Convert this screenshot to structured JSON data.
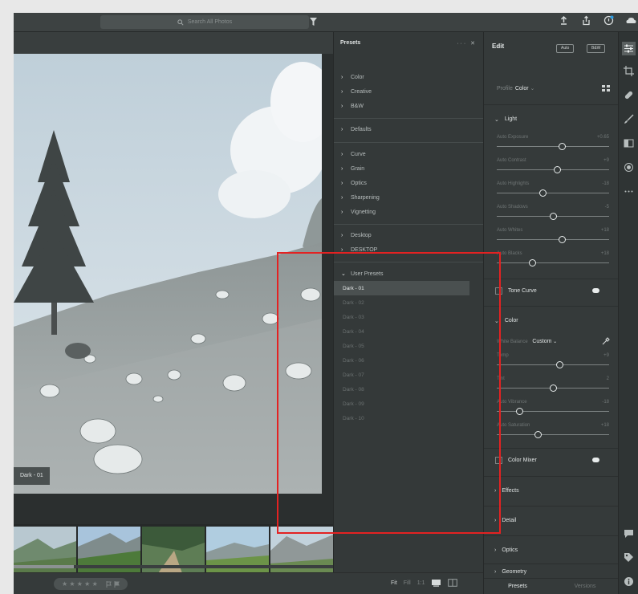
{
  "search": {
    "placeholder": "Search All Photos"
  },
  "photo": {
    "label": "Dark - 01"
  },
  "presets": {
    "title": "Presets",
    "controls": "··· ✕",
    "groups": [
      [
        "Color",
        "Creative",
        "B&W"
      ],
      [
        "Defaults"
      ],
      [
        "Curve",
        "Grain",
        "Optics",
        "Sharpening",
        "Vignetting"
      ],
      [
        "Desktop",
        "DESKTOP"
      ]
    ],
    "user_presets": {
      "title": "User Presets",
      "items": [
        "Dark - 01",
        "Dark - 02",
        "Dark - 03",
        "Dark - 04",
        "Dark - 05",
        "Dark - 06",
        "Dark - 07",
        "Dark - 08",
        "Dark - 09",
        "Dark - 10"
      ],
      "selected": 0
    }
  },
  "edit": {
    "title": "Edit",
    "auto_label": "Auto",
    "bw_label": "B&W",
    "profile_label": "Profile",
    "profile_value": "Color",
    "light": {
      "title": "Light",
      "sliders": [
        {
          "label": "Auto Exposure",
          "value": "+0.65",
          "pos": 0.58
        },
        {
          "label": "Auto Contrast",
          "value": "+9",
          "pos": 0.54
        },
        {
          "label": "Auto Highlights",
          "value": "-18",
          "pos": 0.41
        },
        {
          "label": "Auto Shadows",
          "value": "-5",
          "pos": 0.5
        },
        {
          "label": "Auto Whites",
          "value": "+18",
          "pos": 0.58
        },
        {
          "label": "Auto Blacks",
          "value": "+18",
          "pos": 0.32
        }
      ]
    },
    "tone_curve": "Tone Curve",
    "color": {
      "title": "Color",
      "wb_label": "White Balance",
      "wb_value": "Custom",
      "sliders": [
        {
          "label": "Temp",
          "value": "+9",
          "pos": 0.56
        },
        {
          "label": "Tint",
          "value": "2",
          "pos": 0.5
        },
        {
          "label": "Auto Vibrance",
          "value": "-18",
          "pos": 0.2
        },
        {
          "label": "Auto Saturation",
          "value": "+18",
          "pos": 0.37
        }
      ]
    },
    "color_mixer": "Color Mixer",
    "sections": [
      "Effects",
      "Detail",
      "Optics",
      "Geometry"
    ]
  },
  "bottom": {
    "stars": "★ ★ ★ ★ ★",
    "fit": "Fit",
    "fill": "Fill",
    "ratio": "1:1",
    "tabs": {
      "presets": "Presets",
      "versions": "Versions"
    }
  },
  "colors": {
    "panel": "#353a3a",
    "annotation": "#e32222"
  }
}
